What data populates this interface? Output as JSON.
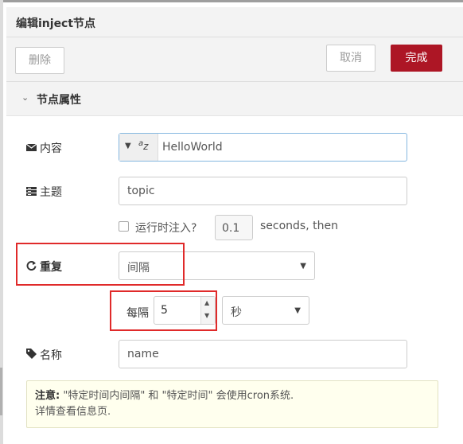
{
  "dialog": {
    "title": "编辑inject节点"
  },
  "toolbar": {
    "delete_label": "删除",
    "cancel_label": "取消",
    "done_label": "完成"
  },
  "section": {
    "title": "节点属性"
  },
  "fields": {
    "payload": {
      "label": "内容",
      "value": "HelloWorld",
      "type_icon": "az-string-icon"
    },
    "topic": {
      "label": "主题",
      "value": "topic"
    },
    "inject_once": {
      "label": "运行时注入?",
      "delay": "0.1",
      "suffix": "seconds, then"
    },
    "repeat": {
      "label": "重复",
      "value": "间隔"
    },
    "every": {
      "label": "每隔",
      "value": "5",
      "unit": "秒"
    },
    "name": {
      "label": "名称",
      "placeholder": "name"
    }
  },
  "note": {
    "bold": "注意:",
    "line1": " \"特定时间内间隔\" 和 \"特定时间\" 会使用cron系统.",
    "line2": "详情查看信息页."
  },
  "colors": {
    "primary": "#ad1625",
    "highlight": "#e02a2a",
    "note_bg": "#ffffee"
  }
}
